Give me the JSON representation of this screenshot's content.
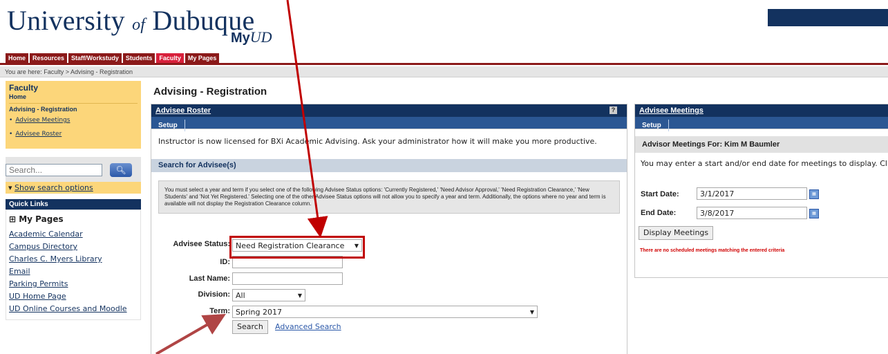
{
  "header": {
    "logo_text_1": "University",
    "logo_of": "of",
    "logo_text_2": "Dubuque",
    "myud_my": "My",
    "myud_ud": "UD"
  },
  "nav_tabs": [
    "Home",
    "Resources",
    "Staff/Workstudy",
    "Students",
    "Faculty",
    "My Pages"
  ],
  "breadcrumb": "You are here:  Faculty > Advising - Registration",
  "leftnav": {
    "faculty_title": "Faculty",
    "home": "Home",
    "selected": "Advising - Registration",
    "items": [
      "Advisee Meetings",
      "Advisee Roster"
    ],
    "search_placeholder": "Search...",
    "show_search_options": "Show search options",
    "quick_links_title": "Quick Links",
    "my_pages": "⊞ My Pages",
    "links": [
      "Academic Calendar",
      "Campus Directory",
      "Charles C. Myers Library",
      "Email",
      "Parking Permits",
      "UD Home Page",
      "UD Online Courses and Moodle"
    ]
  },
  "main": {
    "page_title": "Advising - Registration",
    "roster_title": "Advisee Roster",
    "setup_tab": "Setup",
    "license_msg": "Instructor is now licensed for BXi Academic Advising. Ask your administrator how it will make you more productive.",
    "search_heading": "Search for Advisee(s)",
    "info_text": "You must select a year and term if you select one of the following Advisee Status options: 'Currently Registered,' 'Need Advisor Approval,' 'Need Registration Clearance,' 'New Students' and 'Not Yet Registered.' Selecting one of the other Advisee Status options will not allow you to specify a year and term. Additionally, the options where no year and term is available will not display the Registration Clearance column.",
    "advisee_status_label": "Advisee Status:",
    "advisee_status_value": "Need Registration Clearance",
    "id_label": "ID:",
    "last_name_label": "Last Name:",
    "division_label": "Division:",
    "division_value": "All",
    "term_label": "Term:",
    "term_value": "Spring 2017",
    "search_button": "Search",
    "advanced_search": "Advanced Search"
  },
  "meetings": {
    "title": "Advisee Meetings",
    "setup_tab": "Setup",
    "advisor_heading": "Advisor Meetings For: Kim M Baumler",
    "message": "You may enter a start and/or end date for meetings to display. Click the \"Display Meetings\" button.",
    "start_label": "Start Date:",
    "start_value": "3/1/2017",
    "end_label": "End Date:",
    "end_value": "3/8/2017",
    "display_button": "Display Meetings",
    "no_meetings": "There are no scheduled meetings matching the entered criteria"
  },
  "colors": {
    "navy": "#13325f",
    "maroon": "#8b1a1a",
    "gold": "#fcd67a",
    "highlight_red": "#c00000"
  }
}
